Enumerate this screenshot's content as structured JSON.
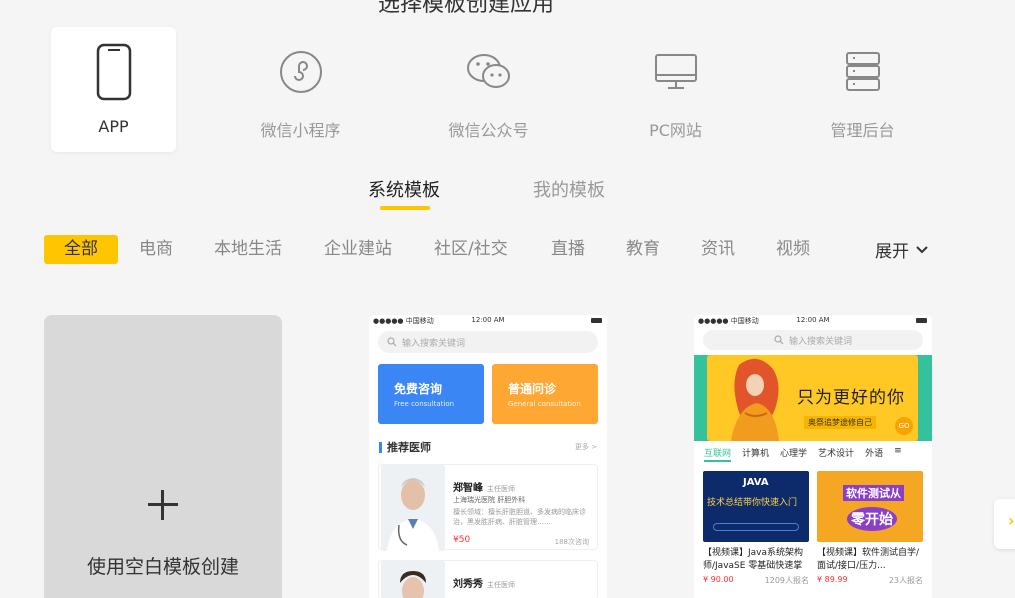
{
  "page_title": "选择模板创建应用",
  "app_types": [
    {
      "label": "APP",
      "icon": "phone-icon",
      "active": true
    },
    {
      "label": "微信小程序",
      "icon": "mini-program-icon",
      "active": false
    },
    {
      "label": "微信公众号",
      "icon": "wechat-icon",
      "active": false
    },
    {
      "label": "PC网站",
      "icon": "monitor-icon",
      "active": false
    },
    {
      "label": "管理后台",
      "icon": "server-icon",
      "active": false
    }
  ],
  "tabs": [
    {
      "label": "系统模板",
      "active": true
    },
    {
      "label": "我的模板",
      "active": false
    }
  ],
  "categories": [
    {
      "label": "全部",
      "active": true
    },
    {
      "label": "电商"
    },
    {
      "label": "本地生活"
    },
    {
      "label": "企业建站"
    },
    {
      "label": "社区/社交"
    },
    {
      "label": "直播"
    },
    {
      "label": "教育"
    },
    {
      "label": "资讯"
    },
    {
      "label": "视频"
    }
  ],
  "expand_label": "展开",
  "blank_template_label": "使用空白模板创建",
  "accent_color": "#ffc600",
  "template_medical": {
    "carrier": "●●●●● 中国移动",
    "time": "12:00 AM",
    "search_placeholder": "输入搜索关键词",
    "cta_left": {
      "title": "免费咨询",
      "subtitle": "Free consultation"
    },
    "cta_right": {
      "title": "普通问诊",
      "subtitle": "General consultation"
    },
    "section_title": "推荐医师",
    "more": "更多 >",
    "doctor1": {
      "name": "郑智峰",
      "title": "主任医师",
      "hospital": "上海瑞光医院  肝胆外科",
      "desc": "擅长领域：擅长肝脏胆道、多发病的临床诊治，黑发胜肝病、肝脏管理……",
      "price": "¥50",
      "count": "188次咨询"
    },
    "doctor2": {
      "name": "刘秀秀",
      "title": "主任医师"
    }
  },
  "template_education": {
    "carrier": "●●●●● 中国移动",
    "time": "12:00 AM",
    "search_placeholder": "输入搜索关键词",
    "banner_slogan": "只为更好的你",
    "banner_sub": "奥祭追梦途修自己",
    "banner_go": "GO",
    "categories": [
      {
        "label": "互联网",
        "active": true
      },
      {
        "label": "计算机"
      },
      {
        "label": "心理学"
      },
      {
        "label": "艺术设计"
      },
      {
        "label": "外语"
      }
    ],
    "courses": [
      {
        "title": "【视频课】Java系统架构师/JavaSE 零基础快速掌",
        "price": "¥ 90.00",
        "enrolled": "1209人报名",
        "thumb_line1": "JAVA",
        "thumb_line2": "技术总结带你快速入门"
      },
      {
        "title": "【视频课】软件测试自学/面试/接口/压力...",
        "price": "¥ 89.99",
        "enrolled": "23人报名",
        "thumb_line1": "软件测试从",
        "thumb_line2": "零开始"
      }
    ]
  }
}
